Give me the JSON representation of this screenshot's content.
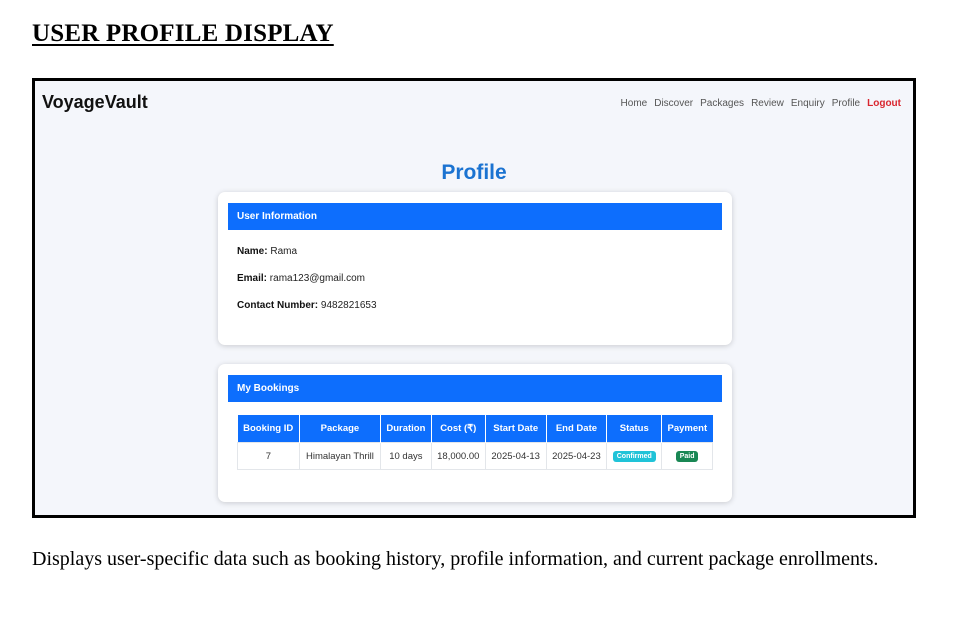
{
  "document": {
    "title": "USER PROFILE DISPLAY",
    "caption": "Displays user-specific data such as booking history, profile information, and current package enrollments."
  },
  "app": {
    "brand": "VoyageVault",
    "nav": {
      "home": "Home",
      "discover": "Discover",
      "packages": "Packages",
      "review": "Review",
      "enquiry": "Enquiry",
      "profile": "Profile",
      "logout": "Logout"
    },
    "page_heading": "Profile",
    "user_info": {
      "header": "User Information",
      "name_label": "Name:",
      "name_value": "Rama",
      "email_label": "Email:",
      "email_value": "rama123@gmail.com",
      "contact_label": "Contact Number:",
      "contact_value": "9482821653"
    },
    "bookings": {
      "header": "My Bookings",
      "columns": [
        "Booking ID",
        "Package",
        "Duration",
        "Cost (₹)",
        "Start Date",
        "End Date",
        "Status",
        "Payment"
      ],
      "rows": [
        {
          "booking_id": "7",
          "package": "Himalayan Thrill",
          "duration": "10 days",
          "cost": "18,000.00",
          "start_date": "2025-04-13",
          "end_date": "2025-04-23",
          "status": "Confirmed",
          "payment": "Paid"
        }
      ]
    }
  },
  "colors": {
    "primary": "#0d6efd",
    "heading_blue": "#1b73d1",
    "logout_red": "#d9262f",
    "status_badge": "#20c3d8",
    "payment_badge": "#198754",
    "page_bg": "#f4f6fb"
  }
}
